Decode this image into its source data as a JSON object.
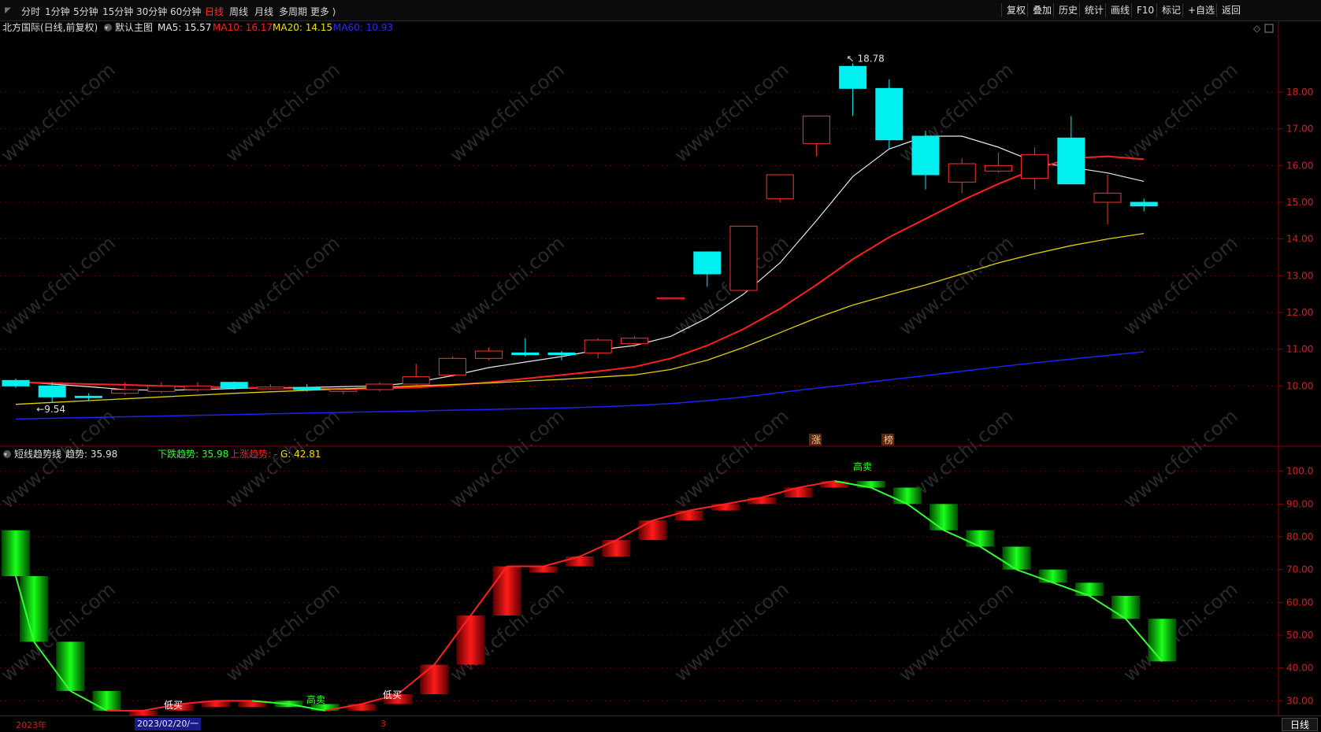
{
  "toolbar": {
    "periods": [
      "分时",
      "1分钟",
      "5分钟",
      "15分钟",
      "30分钟",
      "60分钟",
      "日线",
      "周线",
      "月线",
      "多周期",
      "更多 ⟩"
    ],
    "active_period_index": 6,
    "tools": [
      "复权",
      "叠加",
      "历史",
      "统计",
      "画线",
      "F10",
      "标记",
      "+自选",
      "返回"
    ]
  },
  "main_panel": {
    "stock": "北方国际(日线,前复权)",
    "template": "默认主图",
    "ma": [
      {
        "label": "MA5: 15.57",
        "color": "#e8e8e8"
      },
      {
        "label": "MA10: 16.17",
        "color": "#ff2020"
      },
      {
        "label": "MA20: 14.15",
        "color": "#f0e000"
      },
      {
        "label": "MA60: 10.93",
        "color": "#2a2aff"
      }
    ],
    "high_marker": "18.78",
    "low_marker": "9.54",
    "badge_zhang": "涨",
    "badge_bang": "榜",
    "y_ticks": [
      "18.00",
      "17.00",
      "16.00",
      "15.00",
      "14.00",
      "13.00",
      "12.00",
      "11.00",
      "10.00"
    ],
    "watermark": "www.cfchi.com"
  },
  "chart_data": [
    {
      "type": "candlestick",
      "name": "daily",
      "ylim": [
        9.0,
        19.5
      ],
      "candles": [
        {
          "o": 10.15,
          "c": 10.0,
          "h": 10.2,
          "l": 9.95
        },
        {
          "o": 10.0,
          "c": 9.7,
          "h": 10.1,
          "l": 9.54
        },
        {
          "o": 9.72,
          "c": 9.68,
          "h": 9.8,
          "l": 9.6
        },
        {
          "o": 9.8,
          "c": 9.9,
          "h": 10.1,
          "l": 9.75
        },
        {
          "o": 9.85,
          "c": 10.0,
          "h": 10.1,
          "l": 9.8
        },
        {
          "o": 9.9,
          "c": 10.0,
          "h": 10.1,
          "l": 9.85
        },
        {
          "o": 10.1,
          "c": 9.95,
          "h": 10.12,
          "l": 9.9
        },
        {
          "o": 9.92,
          "c": 9.97,
          "h": 10.05,
          "l": 9.9
        },
        {
          "o": 9.95,
          "c": 9.9,
          "h": 10.05,
          "l": 9.85
        },
        {
          "o": 9.85,
          "c": 9.9,
          "h": 9.95,
          "l": 9.78
        },
        {
          "o": 9.9,
          "c": 10.05,
          "h": 10.1,
          "l": 9.85
        },
        {
          "o": 10.05,
          "c": 10.25,
          "h": 10.6,
          "l": 10.0
        },
        {
          "o": 10.3,
          "c": 10.75,
          "h": 10.8,
          "l": 10.25
        },
        {
          "o": 10.75,
          "c": 10.95,
          "h": 11.05,
          "l": 10.7
        },
        {
          "o": 10.9,
          "c": 10.85,
          "h": 11.3,
          "l": 10.8
        },
        {
          "o": 10.9,
          "c": 10.85,
          "h": 10.95,
          "l": 10.7
        },
        {
          "o": 10.9,
          "c": 11.25,
          "h": 11.3,
          "l": 10.75
        },
        {
          "o": 11.15,
          "c": 11.3,
          "h": 11.35,
          "l": 11.05
        },
        {
          "o": 12.4,
          "c": 12.4,
          "h": 12.4,
          "l": 12.4
        },
        {
          "o": 13.65,
          "c": 13.05,
          "h": 13.65,
          "l": 12.7
        },
        {
          "o": 12.6,
          "c": 14.35,
          "h": 14.35,
          "l": 12.6
        },
        {
          "o": 15.1,
          "c": 15.75,
          "h": 15.75,
          "l": 15.0
        },
        {
          "o": 16.6,
          "c": 17.35,
          "h": 17.35,
          "l": 16.25
        },
        {
          "o": 18.7,
          "c": 18.1,
          "h": 18.78,
          "l": 17.35
        },
        {
          "o": 18.1,
          "c": 16.7,
          "h": 18.35,
          "l": 16.45
        },
        {
          "o": 16.8,
          "c": 15.75,
          "h": 16.95,
          "l": 15.35
        },
        {
          "o": 15.55,
          "c": 16.05,
          "h": 16.2,
          "l": 15.25
        },
        {
          "o": 15.85,
          "c": 16.0,
          "h": 16.35,
          "l": 15.8
        },
        {
          "o": 15.65,
          "c": 16.3,
          "h": 16.5,
          "l": 15.35
        },
        {
          "o": 16.75,
          "c": 15.5,
          "h": 17.35,
          "l": 15.5
        },
        {
          "o": 15.0,
          "c": 15.25,
          "h": 15.75,
          "l": 14.4
        },
        {
          "o": 15.0,
          "c": 14.9,
          "h": 15.1,
          "l": 14.75
        }
      ],
      "ma": {
        "MA5": [
          10.12,
          10.05,
          9.98,
          9.9,
          9.88,
          9.9,
          9.93,
          9.95,
          9.96,
          9.98,
          10.0,
          10.1,
          10.28,
          10.5,
          10.65,
          10.8,
          10.98,
          11.1,
          11.35,
          11.85,
          12.5,
          13.35,
          14.5,
          15.7,
          16.45,
          16.8,
          16.8,
          16.5,
          16.1,
          15.95,
          15.8,
          15.57
        ],
        "MA10": [
          10.1,
          10.08,
          10.05,
          10.03,
          10.0,
          9.98,
          9.96,
          9.94,
          9.93,
          9.92,
          9.93,
          9.96,
          10.02,
          10.1,
          10.2,
          10.3,
          10.4,
          10.52,
          10.75,
          11.1,
          11.55,
          12.1,
          12.75,
          13.45,
          14.05,
          14.55,
          15.05,
          15.5,
          15.9,
          16.2,
          16.25,
          16.17
        ],
        "MA20": [
          9.5,
          9.55,
          9.6,
          9.65,
          9.7,
          9.75,
          9.8,
          9.84,
          9.88,
          9.92,
          9.96,
          10.0,
          10.04,
          10.08,
          10.13,
          10.18,
          10.24,
          10.3,
          10.45,
          10.7,
          11.05,
          11.45,
          11.85,
          12.2,
          12.48,
          12.75,
          13.05,
          13.35,
          13.6,
          13.82,
          14.0,
          14.15
        ],
        "MA60": [
          9.1,
          9.12,
          9.14,
          9.16,
          9.18,
          9.2,
          9.22,
          9.24,
          9.26,
          9.28,
          9.3,
          9.32,
          9.34,
          9.36,
          9.38,
          9.4,
          9.43,
          9.47,
          9.52,
          9.6,
          9.7,
          9.82,
          9.94,
          10.05,
          10.17,
          10.28,
          10.4,
          10.52,
          10.63,
          10.73,
          10.83,
          10.93
        ]
      }
    },
    {
      "type": "bar",
      "name": "短线趋势线",
      "ylim": [
        26,
        104
      ],
      "values": [
        68,
        48,
        33,
        27,
        27,
        29,
        30,
        30,
        29,
        27,
        29,
        32,
        41,
        56,
        71,
        71,
        74,
        79,
        85,
        88,
        90,
        92,
        95,
        97,
        95,
        90,
        82,
        77,
        70,
        66,
        62,
        55,
        42
      ],
      "directions": [
        "down",
        "down",
        "down",
        "down",
        "up",
        "up",
        "up",
        "up",
        "down",
        "down",
        "up",
        "up",
        "up",
        "up",
        "up",
        "up",
        "up",
        "up",
        "up",
        "up",
        "up",
        "up",
        "up",
        "up",
        "down",
        "down",
        "down",
        "down",
        "down",
        "down",
        "down",
        "down",
        "down"
      ]
    }
  ],
  "sub_panel": {
    "indicator": "短线趋势线",
    "trend_label": "趋势: 35.98",
    "down_label": "下跌趋势: 35.98",
    "up_label": "上涨趋势: -",
    "g_label": "G: 42.81",
    "y_ticks": [
      "100.0",
      "90.00",
      "80.00",
      "70.00",
      "60.00",
      "50.00",
      "40.00",
      "30.00"
    ],
    "annotations": [
      "低买",
      "高卖",
      "低买",
      "高卖"
    ]
  },
  "bottom_bar": {
    "year": "2023年",
    "date": "2023/02/20/一",
    "tick": "3",
    "period_button": "日线"
  },
  "colors": {
    "up": "#ff3030",
    "down": "#00f0f0",
    "axis": "#8b0000",
    "grid": "#5a0000"
  }
}
